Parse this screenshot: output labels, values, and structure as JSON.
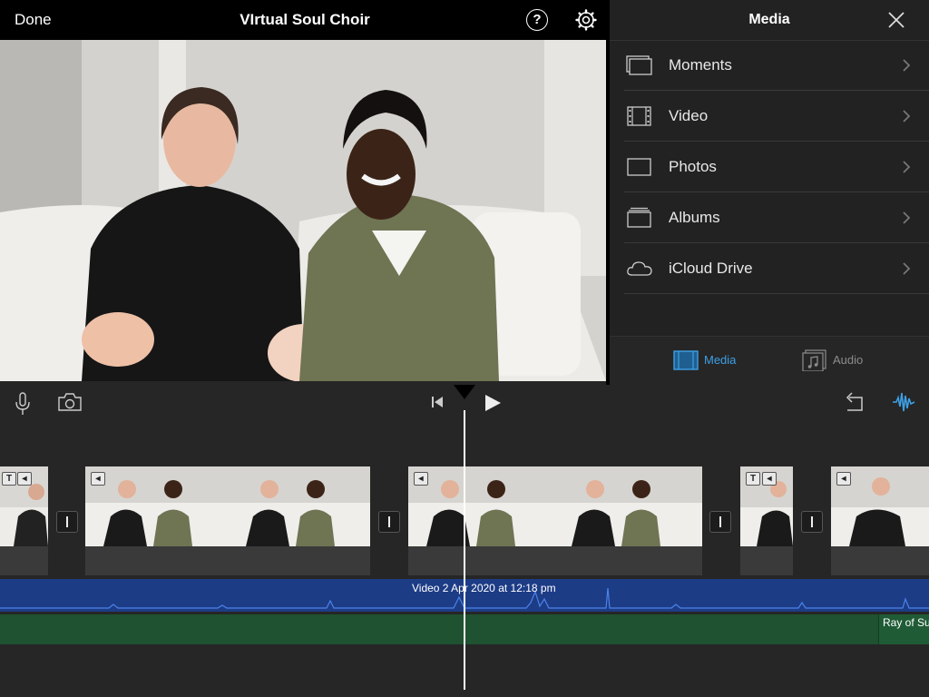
{
  "topbar": {
    "done_label": "Done",
    "title": "VIrtual Soul Choir",
    "help_label": "?"
  },
  "media": {
    "title": "Media",
    "items": [
      {
        "label": "Moments",
        "icon": "moments-icon"
      },
      {
        "label": "Video",
        "icon": "film-icon"
      },
      {
        "label": "Photos",
        "icon": "photo-icon"
      },
      {
        "label": "Albums",
        "icon": "albums-icon"
      },
      {
        "label": "iCloud Drive",
        "icon": "cloud-icon"
      }
    ],
    "tabs": {
      "media_label": "Media",
      "audio_label": "Audio"
    }
  },
  "timeline": {
    "audio_track_label": "Video 2 Apr 2020 at 12:18 pm",
    "music_track_label": "Ray of Su"
  },
  "colors": {
    "accent": "#3da0e6",
    "audio_blue": "#1d3c86",
    "audio_green": "#1e5231",
    "background": "#262626"
  }
}
